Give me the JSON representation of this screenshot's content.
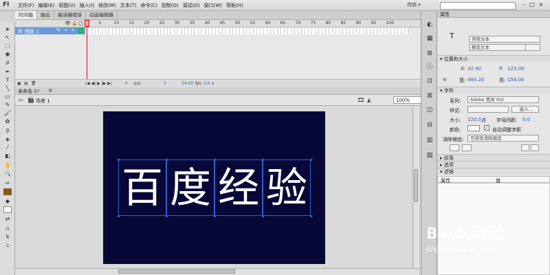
{
  "app": {
    "logo": "Fl",
    "workspace": "传统 ▾"
  },
  "menu": [
    "文件(F)",
    "编辑(E)",
    "视图(V)",
    "插入(I)",
    "修改(M)",
    "文本(T)",
    "命令(C)",
    "控制(O)",
    "调试(D)",
    "窗口(W)",
    "帮助(H)"
  ],
  "tabs": [
    "时间轴",
    "输出",
    "编译器错误",
    "动画编辑器"
  ],
  "timeline": {
    "layer_name": "图层 1",
    "ruler": [
      "1",
      "5",
      "10",
      "15",
      "20",
      "25",
      "30",
      "35",
      "40",
      "45",
      "50",
      "55",
      "60",
      "65",
      "70",
      "75",
      "80",
      "85",
      "90",
      "95",
      "100"
    ],
    "frame": "1",
    "fps": "24.00",
    "fps_unit": "fps",
    "time": "0.0",
    "time_unit": "s"
  },
  "document": {
    "tab": "未命名-1*",
    "close": "×",
    "scene": "场景 1",
    "zoom": "100%"
  },
  "stage": {
    "text": [
      "百",
      "度",
      "经",
      "验"
    ],
    "bg": "#080838"
  },
  "properties": {
    "title": "属性",
    "text_tool_type": "传统文本",
    "text_kind": "静态文本",
    "pos_size": {
      "header": "位置和大小",
      "x_label": "X:",
      "x": "32.90",
      "y_label": "Y:",
      "y": "123.00",
      "w_label": "宽:",
      "w": "484.20",
      "h_label": "高:",
      "h": "154.00"
    },
    "char": {
      "header": "字符",
      "family_label": "系列:",
      "family": "Adobe 黑体 Std",
      "style_label": "样式:",
      "embed": "嵌入...",
      "size_label": "大小:",
      "size": "120.0",
      "size_unit": "点",
      "spacing_label": "字母间距:",
      "spacing": "0.0",
      "color_label": "颜色:",
      "autokern": "自动调整字距",
      "aa_label": "消除锯齿:",
      "aa": "可读性消除锯齿"
    },
    "para": "段落",
    "options": "选项",
    "filters": "滤镜",
    "filter_cols": [
      "属性",
      "值"
    ]
  },
  "watermark": {
    "brand": "Baidu经验",
    "url": "jingyan.baidu.com"
  }
}
